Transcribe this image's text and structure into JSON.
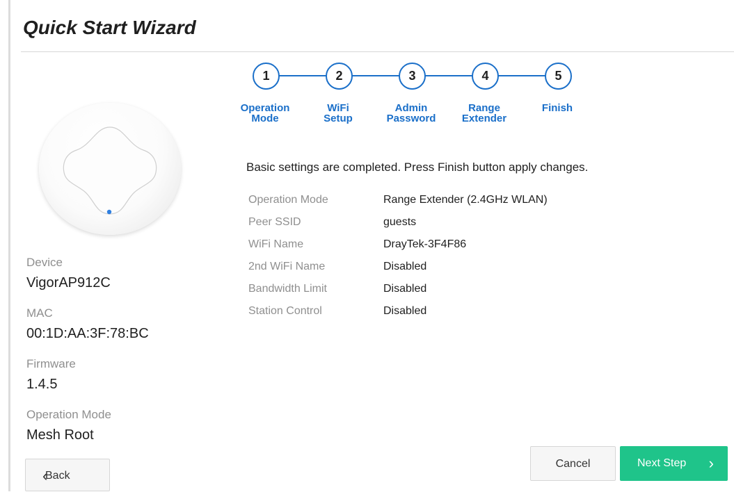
{
  "title": "Quick Start Wizard",
  "device_info": {
    "device_label": "Device",
    "device_value": "VigorAP912C",
    "mac_label": "MAC",
    "mac_value": "00:1D:AA:3F:78:BC",
    "firmware_label": "Firmware",
    "firmware_value": "1.4.5",
    "mode_label": "Operation Mode",
    "mode_value": "Mesh Root"
  },
  "steps": [
    {
      "number": "1",
      "label_line1": "Operation",
      "label_line2": "Mode"
    },
    {
      "number": "2",
      "label_line1": "WiFi",
      "label_line2": "Setup"
    },
    {
      "number": "3",
      "label_line1": "Admin",
      "label_line2": "Password"
    },
    {
      "number": "4",
      "label_line1": "Range",
      "label_line2": "Extender"
    },
    {
      "number": "5",
      "label_line1": "Finish",
      "label_line2": ""
    }
  ],
  "message": "Basic settings are completed. Press Finish button apply changes.",
  "summary": [
    {
      "key": "Operation Mode",
      "value": "Range Extender (2.4GHz WLAN)"
    },
    {
      "key": "Peer SSID",
      "value": "guests"
    },
    {
      "key": "WiFi Name",
      "value": "DrayTek-3F4F86"
    },
    {
      "key": "2nd WiFi Name",
      "value": "Disabled"
    },
    {
      "key": "Bandwidth Limit",
      "value": "Disabled"
    },
    {
      "key": "Station Control",
      "value": "Disabled"
    }
  ],
  "buttons": {
    "back": "Back",
    "cancel": "Cancel",
    "next": "Next Step"
  },
  "colors": {
    "accent_blue": "#1a6fc9",
    "next_green": "#1fc48a",
    "status_led": "#2f7fe0"
  },
  "icons": {
    "back": "chevron-left-icon",
    "next": "chevron-right-icon"
  }
}
